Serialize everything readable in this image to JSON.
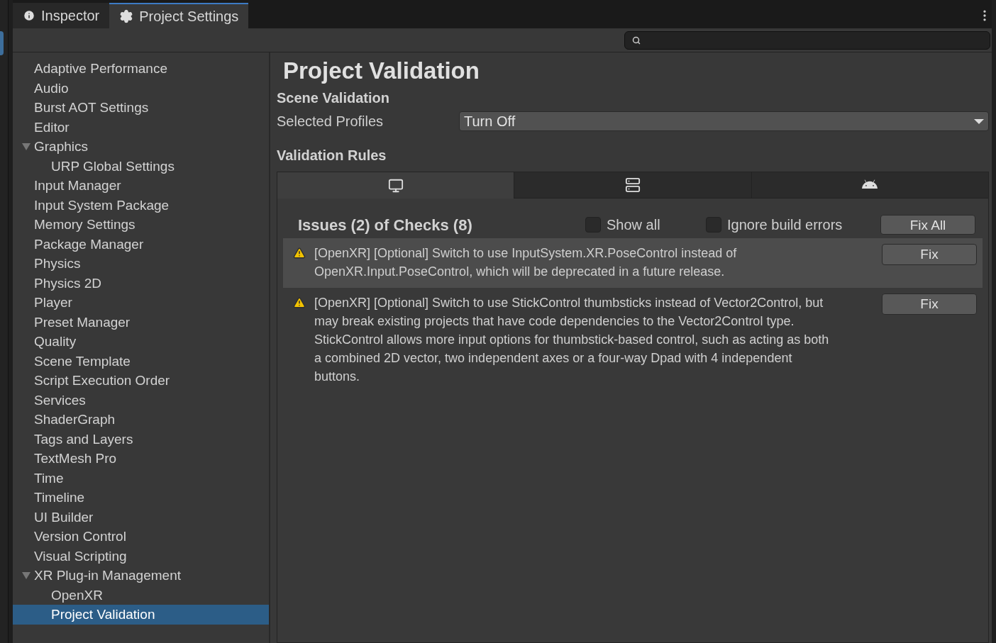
{
  "tabs": [
    {
      "label": "Inspector",
      "kind": "info",
      "selected": false
    },
    {
      "label": "Project Settings",
      "kind": "gear",
      "selected": true
    }
  ],
  "sidebar": {
    "items": [
      {
        "label": "Adaptive Performance",
        "selected": false
      },
      {
        "label": "Audio",
        "selected": false
      },
      {
        "label": "Burst AOT Settings",
        "selected": false
      },
      {
        "label": "Editor",
        "selected": false
      },
      {
        "label": "Graphics",
        "selected": false,
        "expanded": true,
        "children": [
          {
            "label": "URP Global Settings",
            "selected": false
          }
        ]
      },
      {
        "label": "Input Manager",
        "selected": false
      },
      {
        "label": "Input System Package",
        "selected": false
      },
      {
        "label": "Memory Settings",
        "selected": false
      },
      {
        "label": "Package Manager",
        "selected": false
      },
      {
        "label": "Physics",
        "selected": false
      },
      {
        "label": "Physics 2D",
        "selected": false
      },
      {
        "label": "Player",
        "selected": false
      },
      {
        "label": "Preset Manager",
        "selected": false
      },
      {
        "label": "Quality",
        "selected": false
      },
      {
        "label": "Scene Template",
        "selected": false
      },
      {
        "label": "Script Execution Order",
        "selected": false
      },
      {
        "label": "Services",
        "selected": false
      },
      {
        "label": "ShaderGraph",
        "selected": false
      },
      {
        "label": "Tags and Layers",
        "selected": false
      },
      {
        "label": "TextMesh Pro",
        "selected": false
      },
      {
        "label": "Time",
        "selected": false
      },
      {
        "label": "Timeline",
        "selected": false
      },
      {
        "label": "UI Builder",
        "selected": false
      },
      {
        "label": "Version Control",
        "selected": false
      },
      {
        "label": "Visual Scripting",
        "selected": false
      },
      {
        "label": "XR Plug-in Management",
        "selected": false,
        "expanded": true,
        "children": [
          {
            "label": "OpenXR",
            "selected": false
          },
          {
            "label": "Project Validation",
            "selected": true
          }
        ]
      }
    ]
  },
  "content": {
    "title": "Project Validation",
    "scene_heading": "Scene Validation",
    "profiles_label": "Selected Profiles",
    "profiles_value": "Turn Off",
    "rules_heading": "Validation Rules",
    "platform_tabs": [
      {
        "kind": "desktop",
        "selected": true
      },
      {
        "kind": "server",
        "selected": false
      },
      {
        "kind": "android",
        "selected": false
      }
    ],
    "issues_title": "Issues (2) of Checks (8)",
    "checkboxes": [
      {
        "label": "Show all",
        "checked": false
      },
      {
        "label": "Ignore build errors",
        "checked": false
      }
    ],
    "fix_all": "Fix All",
    "issues": [
      {
        "text": "[OpenXR] [Optional] Switch to use InputSystem.XR.PoseControl instead of OpenXR.Input.PoseControl, which will be deprecated in a future release.",
        "button": "Fix",
        "highlighted": true
      },
      {
        "text": "[OpenXR] [Optional] Switch to use StickControl thumbsticks instead of Vector2Control, but may break existing projects that have code dependencies to the Vector2Control type. StickControl allows more input options for thumbstick-based control, such as acting as both a combined 2D vector, two independent axes or a four-way Dpad with 4 independent buttons.",
        "button": "Fix",
        "highlighted": false
      }
    ]
  }
}
